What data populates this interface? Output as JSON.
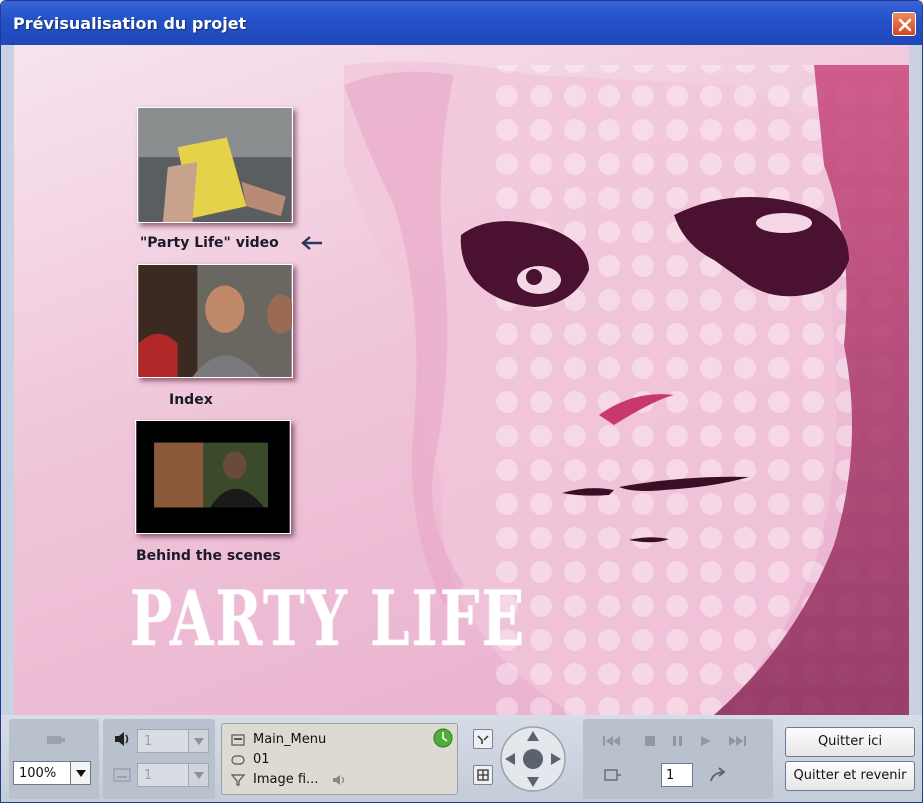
{
  "window": {
    "title": "Prévisualisation du projet"
  },
  "menu": {
    "items": [
      {
        "label": "\"Party Life\" video"
      },
      {
        "label": "Index"
      },
      {
        "label": "Behind the scenes"
      }
    ],
    "logo_text": "PARTY LIFE",
    "selection_icon": "left-arrow-icon"
  },
  "controls": {
    "zoom_value": "100%",
    "audio_stream": "1",
    "subtitle_stream": "1",
    "info": {
      "menu_name": "Main_Menu",
      "button_number": "01",
      "item_type": "Image fi..."
    },
    "frame_value": "1",
    "quit_here": "Quitter ici",
    "quit_and_return": "Quitter et revenir"
  },
  "colors": {
    "titlebar": "#2452c9",
    "stage_pink": "#e9aecd",
    "face_dark": "#4a1230"
  }
}
